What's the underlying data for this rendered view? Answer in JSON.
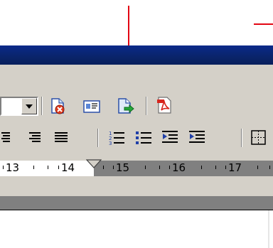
{
  "annotation": {
    "arrow_color": "#e30613"
  },
  "window": {
    "title_bar_color": "#0a246a",
    "chrome_color": "#d4d0c8"
  },
  "toolbar_standard": {
    "dropdown": {
      "value": ""
    },
    "buttons": [
      {
        "name": "delete-page-icon"
      },
      {
        "name": "address-card-icon"
      },
      {
        "name": "export-page-icon"
      },
      {
        "name": "pdf-icon"
      }
    ]
  },
  "toolbar_formatting": {
    "buttons": [
      {
        "name": "align-center-icon"
      },
      {
        "name": "align-right-icon"
      },
      {
        "name": "justify-icon"
      },
      {
        "name": "numbered-list-icon"
      },
      {
        "name": "bulleted-list-icon"
      },
      {
        "name": "decrease-indent-icon"
      },
      {
        "name": "increase-indent-icon"
      },
      {
        "name": "borders-icon"
      }
    ]
  },
  "ruler": {
    "labels": [
      "13",
      "14",
      "15",
      "16",
      "17"
    ]
  }
}
